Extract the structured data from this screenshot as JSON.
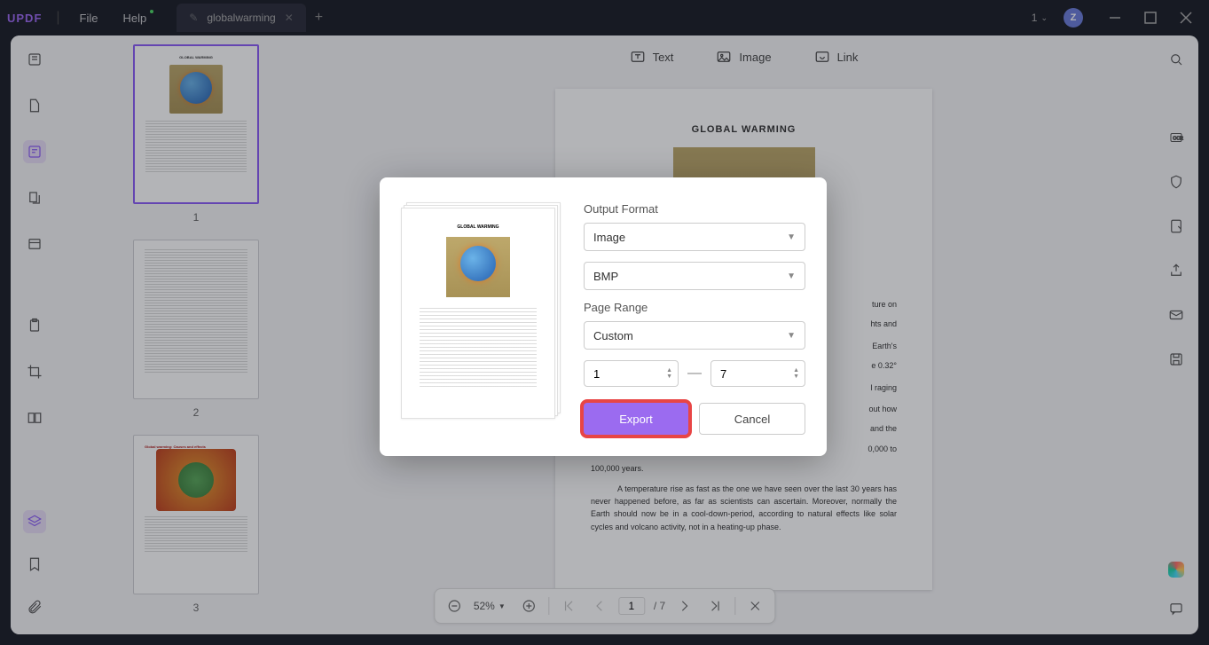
{
  "app": {
    "name": "UPDF"
  },
  "menu": {
    "file": "File",
    "help": "Help"
  },
  "tab": {
    "title": "globalwarming"
  },
  "window": {
    "page_current": "1",
    "avatar_initial": "Z"
  },
  "top_tools": {
    "text": "Text",
    "image": "Image",
    "link": "Link"
  },
  "thumbnails": {
    "p1": "1",
    "p2": "2",
    "p3": "3"
  },
  "document": {
    "title": "GLOBAL WARMING",
    "para1_tail": "ture on",
    "para1_tail2": "hts and",
    "para2_tail": "Earth's",
    "para2_tail2": "e 0.32°",
    "para3_tail": "l raging",
    "para4": "out how",
    "para4b": "and the",
    "para4c": "0,000 to",
    "para4d": "100,000 years.",
    "para5": "A temperature rise as fast as the one we have seen over the last 30 years has never happened before, as far as scientists can ascertain. Moreover, normally the Earth should now be in a cool-down-period, according to natural effects like solar cycles and volcano activity, not in a heating-up phase."
  },
  "dialog": {
    "output_format_label": "Output Format",
    "format_value": "Image",
    "subformat_value": "BMP",
    "page_range_label": "Page Range",
    "range_value": "Custom",
    "range_from": "1",
    "range_to": "7",
    "export_label": "Export",
    "cancel_label": "Cancel"
  },
  "footer": {
    "zoom": "52%",
    "page_current": "1",
    "page_sep": "/",
    "page_total": "7"
  }
}
